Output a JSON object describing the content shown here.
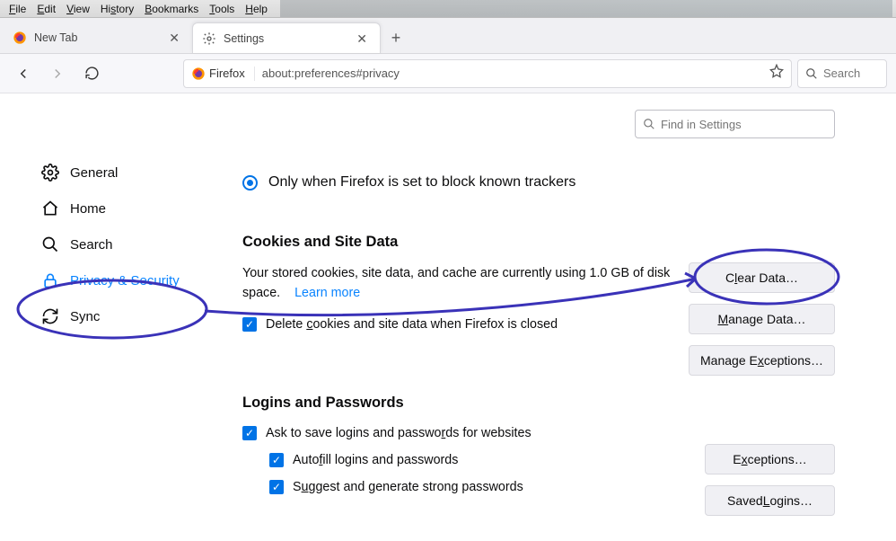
{
  "menubar": [
    "File",
    "Edit",
    "View",
    "History",
    "Bookmarks",
    "Tools",
    "Help"
  ],
  "tabs": {
    "items": [
      {
        "label": "New Tab",
        "active": false
      },
      {
        "label": "Settings",
        "active": true
      }
    ],
    "add": "+"
  },
  "toolbar": {
    "identity_label": "Firefox",
    "url": "about:preferences#privacy",
    "search_placeholder": "Search"
  },
  "find_placeholder": "Find in Settings",
  "sidebar": {
    "items": [
      {
        "label": "General",
        "name": "sidebar-item-general"
      },
      {
        "label": "Home",
        "name": "sidebar-item-home"
      },
      {
        "label": "Search",
        "name": "sidebar-item-search"
      },
      {
        "label": "Privacy & Security",
        "name": "sidebar-item-privacy",
        "active": true
      },
      {
        "label": "Sync",
        "name": "sidebar-item-sync"
      }
    ]
  },
  "tracking": {
    "option_label": "Only when Firefox is set to block known trackers"
  },
  "cookies": {
    "title": "Cookies and Site Data",
    "desc": "Your stored cookies, site data, and cache are currently using 1.0 GB of disk space.",
    "learn": "Learn more",
    "delete": "Delete cookies and site data when Firefox is closed",
    "btn_clear": "Clear Data…",
    "btn_manage": "Manage Data…",
    "btn_exceptions": "Manage Exceptions…"
  },
  "logins": {
    "title": "Logins and Passwords",
    "ask": "Ask to save logins and passwords for websites",
    "autofill": "Autofill logins and passwords",
    "suggest": "Suggest and generate strong passwords",
    "btn_exceptions": "Exceptions…",
    "btn_saved": "Saved Logins…"
  }
}
